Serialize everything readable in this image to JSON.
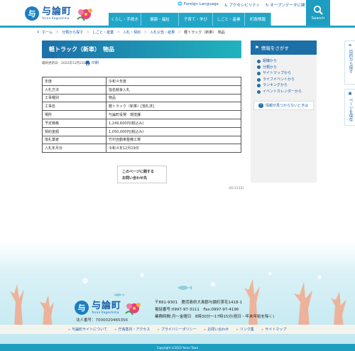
{
  "header": {
    "logo_mark": "与",
    "logo_title": "与論町",
    "logo_sub": "Yoron Kagoshima",
    "top_links": [
      "Foreign Language",
      "アクセシビリティ",
      "オープンデータに関する"
    ],
    "nav": [
      "くらし・手続き",
      "健康・福祉",
      "子育て・学び",
      "しごと・産業",
      "町政情報"
    ],
    "search_label": "Search"
  },
  "breadcrumb": [
    "ホーム",
    "分類から探す",
    "しごと・産業",
    "入札・契約",
    "入札公告・結果",
    "軽トラック（新車）　物品"
  ],
  "page": {
    "title": "軽トラック（新車）　物品",
    "updated": "最終更新日：2022年12月21日",
    "print": "印刷"
  },
  "table": [
    {
      "k": "年度",
      "v": "令和４年度"
    },
    {
      "k": "入札方法",
      "v": "指名競争入札"
    },
    {
      "k": "工事種別",
      "v": "物品"
    },
    {
      "k": "工事名",
      "v": "軽トラック（新車）[落札済]"
    },
    {
      "k": "場所",
      "v": "与論町役場　環境課"
    },
    {
      "k": "予定価格",
      "v": "1,249,600円(税込み)"
    },
    {
      "k": "契約金額",
      "v": "1,050,000円(税込み)"
    },
    {
      "k": "落札業者",
      "v": "竹村自動車整備工場"
    },
    {
      "k": "入札年月日",
      "v": "令和４年12月19日"
    }
  ],
  "contact": {
    "line1": "このページに関する",
    "line2": "お問い合わせ先"
  },
  "page_id": "(ID:1233)",
  "side": {
    "title": "情報をさがす",
    "items": [
      "組織から",
      "分類から",
      "サイトマップから",
      "ライフイベントから",
      "ランキングから",
      "イベントカレンダーから"
    ],
    "help": "情報が見つからないときは"
  },
  "float_tabs": {
    "t1": "目的から探す",
    "t2": "ページを保存"
  },
  "footer": {
    "corp_no": "法人番号：7000020465356",
    "address": "〒891-9301　鹿児島県大島郡与論町茶花1418-1",
    "tel": "電話番号:0997-97-3111　Fax:0997-97-4196",
    "hours": "業務時間:月～金曜日　8時30分～17時15分(祝日・年末年始を除く)",
    "links": [
      "与論町サイトについて",
      "庁舎案内・アクセス",
      "プライバシーポリシー",
      "お問い合わせ",
      "リンク集",
      "サイトマップ"
    ],
    "copyright": "Copyright ©2023 Yoron Town"
  },
  "colors": {
    "brand": "#1a5fa8",
    "accent": "#22a6c8"
  }
}
